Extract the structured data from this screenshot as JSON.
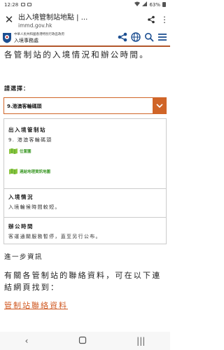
{
  "status_bar": {
    "time": "12:28",
    "battery": "63%"
  },
  "browser": {
    "page_title": "出入境管制站地點 | ...",
    "url": "immd.gov.hk"
  },
  "site": {
    "dept_line1": "中華人民共和國香港特別行政區政府",
    "dept_line2": "入境事務處"
  },
  "intro_text": "各管制站的入境情況和辦公時間。",
  "select": {
    "label": "請選擇：",
    "value": "9.港澳客輪碼頭"
  },
  "card": {
    "station_heading": "出入境管制站",
    "station_name": "9. 港澳客輪碼頭",
    "location_link": "位置圖",
    "geo_link": "連結地理資訊地圖",
    "entry_heading": "入境情況",
    "entry_text": "入境輪候時間較短。",
    "hours_heading": "辦公時間",
    "hours_text": "客運通關服務暫停，直至另行公布。"
  },
  "further_heading": "進一步資訊",
  "contact_text": "有關各管制站的聯絡資料，可在以下連結網頁找到：",
  "contact_link": "管制站聯絡資料",
  "colors": {
    "accent": "#d06528",
    "link": "#d05a23",
    "map_green": "#3f9a2a"
  }
}
